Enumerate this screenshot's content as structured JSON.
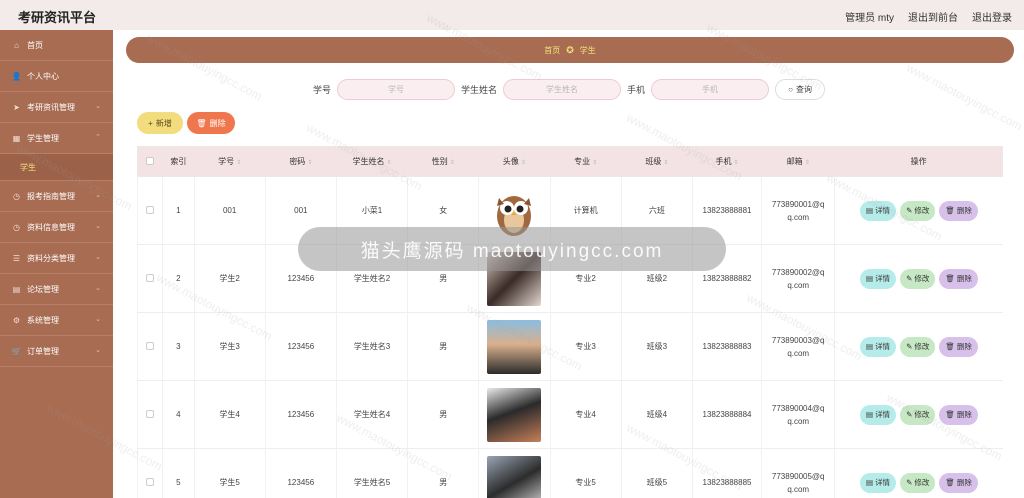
{
  "header": {
    "title": "考研资讯平台",
    "user": "管理员 mty",
    "to_front": "退出到前台",
    "logout": "退出登录"
  },
  "sidebar": {
    "items": [
      {
        "label": "首页",
        "icon": "home-icon"
      },
      {
        "label": "个人中心",
        "icon": "user-icon"
      },
      {
        "label": "考研资讯管理",
        "icon": "send-icon"
      },
      {
        "label": "学生管理",
        "icon": "grid-icon"
      },
      {
        "label": "报考指南管理",
        "icon": "clock-icon"
      },
      {
        "label": "资料信息管理",
        "icon": "clock-icon"
      },
      {
        "label": "资料分类管理",
        "icon": "list-icon"
      },
      {
        "label": "论坛管理",
        "icon": "forum-icon"
      },
      {
        "label": "系统管理",
        "icon": "gear-icon"
      },
      {
        "label": "订单管理",
        "icon": "cart-icon"
      }
    ],
    "sub_active": "学生"
  },
  "breadcrumb": {
    "home": "首页",
    "current": "学生"
  },
  "search": {
    "label1": "学号",
    "placeholder1": "学号",
    "label2": "学生姓名",
    "placeholder2": "学生姓名",
    "label3": "手机",
    "placeholder3": "手机",
    "query": "查询"
  },
  "actions": {
    "add": "新增",
    "delete": "删除"
  },
  "table": {
    "headers": [
      "索引",
      "学号",
      "密码",
      "学生姓名",
      "性别",
      "头像",
      "专业",
      "班级",
      "手机",
      "邮箱",
      "操作"
    ],
    "rows": [
      {
        "idx": "1",
        "no": "001",
        "pwd": "001",
        "name": "小菜1",
        "sex": "女",
        "major": "计算机",
        "cls": "六班",
        "phone": "13823888881",
        "email1": "773890001@q",
        "email2": "q.com"
      },
      {
        "idx": "2",
        "no": "学生2",
        "pwd": "123456",
        "name": "学生姓名2",
        "sex": "男",
        "major": "专业2",
        "cls": "班级2",
        "phone": "13823888882",
        "email1": "773890002@q",
        "email2": "q.com"
      },
      {
        "idx": "3",
        "no": "学生3",
        "pwd": "123456",
        "name": "学生姓名3",
        "sex": "男",
        "major": "专业3",
        "cls": "班级3",
        "phone": "13823888883",
        "email1": "773890003@q",
        "email2": "q.com"
      },
      {
        "idx": "4",
        "no": "学生4",
        "pwd": "123456",
        "name": "学生姓名4",
        "sex": "男",
        "major": "专业4",
        "cls": "班级4",
        "phone": "13823888884",
        "email1": "773890004@q",
        "email2": "q.com"
      },
      {
        "idx": "5",
        "no": "学生5",
        "pwd": "123456",
        "name": "学生姓名5",
        "sex": "男",
        "major": "专业5",
        "cls": "班级5",
        "phone": "13823888885",
        "email1": "773890005@q",
        "email2": "q.com"
      }
    ],
    "row_actions": {
      "detail": "详情",
      "edit": "修改",
      "remove": "删除"
    }
  },
  "watermark": {
    "banner": "猫头鹰源码 maotouyingcc.com",
    "tile": "www.maotouyingcc.com"
  },
  "colors": {
    "sidebar": "#a86c52",
    "accent": "#f6e27a",
    "delete": "#f0764e"
  }
}
